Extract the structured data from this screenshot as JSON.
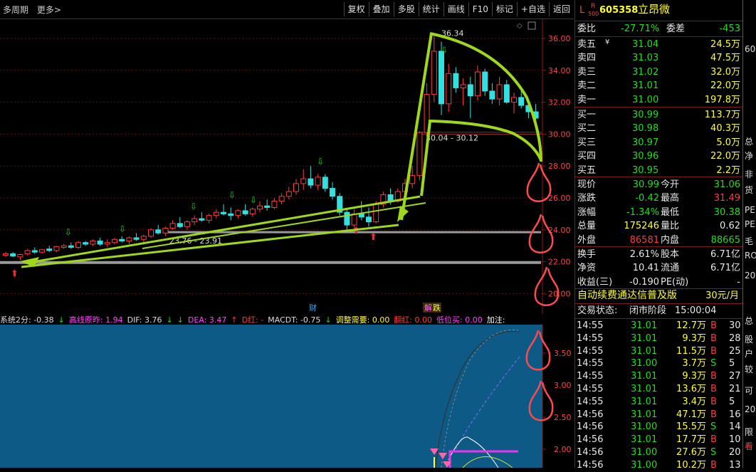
{
  "toolbar": {
    "period": "多周期",
    "more": "更多>",
    "buttons": [
      "复权",
      "叠加",
      "多股",
      "统计",
      "画线",
      "F10",
      "标记",
      "+自选",
      "返回"
    ]
  },
  "header": {
    "badge_l": "L",
    "badge_r": "R",
    "badge_500": "500",
    "code": "605358",
    "name": "立昂微"
  },
  "order_book": {
    "weibi_label": "委比",
    "weibi_value": "-27.71%",
    "weicha_label": "委差",
    "weicha_value": "-453",
    "asks": [
      {
        "label": "卖五",
        "mark": "¥",
        "price": "31.04",
        "vol": "24.5万"
      },
      {
        "label": "卖四",
        "mark": "",
        "price": "31.03",
        "vol": "47.5万"
      },
      {
        "label": "卖三",
        "mark": "",
        "price": "31.02",
        "vol": "32.0万"
      },
      {
        "label": "卖二",
        "mark": "",
        "price": "31.01",
        "vol": "22.0万"
      },
      {
        "label": "卖一",
        "mark": "",
        "price": "31.00",
        "vol": "197.8万"
      }
    ],
    "bids": [
      {
        "label": "买一",
        "price": "30.99",
        "vol": "113.7万"
      },
      {
        "label": "买二",
        "price": "30.98",
        "vol": "40.3万"
      },
      {
        "label": "买三",
        "price": "30.97",
        "vol": "5.0万"
      },
      {
        "label": "买四",
        "price": "30.96",
        "vol": "22.0万"
      },
      {
        "label": "买五",
        "price": "30.95",
        "vol": "2.2万"
      }
    ]
  },
  "quote": {
    "rows": [
      {
        "l1": "现价",
        "v1": "30.99",
        "c1": "grn",
        "l2": "今开",
        "v2": "31.06",
        "c2": "grn"
      },
      {
        "l1": "涨跌",
        "v1": "-0.42",
        "c1": "grn",
        "l2": "最高",
        "v2": "31.49",
        "c2": "red"
      },
      {
        "l1": "涨幅",
        "v1": "-1.34%",
        "c1": "grn",
        "l2": "最低",
        "v2": "30.38",
        "c2": "grn"
      },
      {
        "l1": "总量",
        "v1": "175246",
        "c1": "yel",
        "l2": "量比",
        "v2": "0.62",
        "c2": "wht"
      },
      {
        "l1": "外盘",
        "v1": "86581",
        "c1": "red",
        "l2": "内盘",
        "v2": "88665",
        "c2": "grn"
      }
    ],
    "rows2": [
      {
        "l1": "换手",
        "v1": "2.61%",
        "l2": "股本",
        "v2": "6.71亿"
      },
      {
        "l1": "净资",
        "v1": "10.41",
        "l2": "流通",
        "v2": "6.71亿"
      },
      {
        "l1": "收益(三)",
        "v1": "-0.190",
        "l2": "PE(动)",
        "v2": "-"
      }
    ]
  },
  "promo": {
    "text": "自动续费通达信普及版",
    "price": "30元/月"
  },
  "trade_status": {
    "label": "交易状态:",
    "value": "闭市阶段",
    "time": "15:00:04"
  },
  "ticks": [
    {
      "t": "14:55",
      "p": "31.01",
      "v": "12.7万",
      "d": "B",
      "n": "30"
    },
    {
      "t": "14:55",
      "p": "31.01",
      "v": "9.3万",
      "d": "B",
      "n": "28"
    },
    {
      "t": "14:55",
      "p": "31.01",
      "v": "11.5万",
      "d": "B",
      "n": "25"
    },
    {
      "t": "14:55",
      "p": "31.00",
      "v": "3.7万",
      "d": "S",
      "n": "5"
    },
    {
      "t": "14:55",
      "p": "31.01",
      "v": "9.3万",
      "d": "B",
      "n": "27"
    },
    {
      "t": "14:55",
      "p": "31.01",
      "v": "13.6万",
      "d": "B",
      "n": "21"
    },
    {
      "t": "14:55",
      "p": "31.01",
      "v": "3.4万",
      "d": "B",
      "n": "5"
    },
    {
      "t": "14:56",
      "p": "31.01",
      "v": "47.1万",
      "d": "B",
      "n": "16"
    },
    {
      "t": "14:56",
      "p": "31.00",
      "v": "15.5万",
      "d": "S",
      "n": "14"
    },
    {
      "t": "14:56",
      "p": "31.01",
      "v": "17.7万",
      "d": "B",
      "n": "10"
    },
    {
      "t": "14:56",
      "p": "31.00",
      "v": "27.6万",
      "d": "S",
      "n": "20"
    },
    {
      "t": "14:56",
      "p": "31.00",
      "v": "10.2万",
      "d": "B",
      "n": "13"
    }
  ],
  "price_axis": [
    "36.00",
    "34.00",
    "32.00",
    "30.00",
    "28.00",
    "26.00",
    "24.00",
    "22.00",
    "20.00"
  ],
  "ind_axis": [
    "3.50",
    "3.00",
    "2.50",
    "2.00"
  ],
  "annotations": {
    "high": "36.34",
    "gap": "30.04 - 30.12",
    "support": "23.76 - 23.91",
    "cai": "财",
    "jie": "解",
    "die": "跌"
  },
  "indicator_bar": [
    {
      "text": "系统2分: -0.38",
      "color": "#dddddd"
    },
    {
      "text": "↓",
      "color": "#22dd22"
    },
    {
      "text": "高线原昨: 1.94",
      "color": "#ff44ff"
    },
    {
      "text": "DIF: 3.76",
      "color": "#dddddd"
    },
    {
      "text": "↓",
      "color": "#22dd22"
    },
    {
      "text": "↓",
      "color": "#22dd22"
    },
    {
      "text": "DEA: 3.47",
      "color": "#ff44ff"
    },
    {
      "text": "↑",
      "color": "#ff3b3b"
    },
    {
      "text": "D红: -",
      "color": "#ff3b3b"
    },
    {
      "text": "MACDT: -0.75",
      "color": "#dddddd"
    },
    {
      "text": "↓",
      "color": "#22dd22"
    },
    {
      "text": "调整需要: 0.00",
      "color": "#ffff33"
    },
    {
      "text": "翻红: 0.00",
      "color": "#ff3b3b"
    },
    {
      "text": "低位买: 0.00",
      "color": "#ff44ff"
    },
    {
      "text": "加注:",
      "color": "#ffffff"
    }
  ],
  "edge_labels": [
    "60",
    "总",
    "净",
    "非",
    "货",
    "PE",
    "PE",
    "毛",
    "RO",
    "20",
    "总",
    "股",
    "户",
    "较",
    "可",
    "20",
    "限",
    "看"
  ],
  "colors": {
    "up": "#ff3b3b",
    "down": "#33e0e0",
    "annotation_green": "#9ed81b",
    "annotation_red": "#ff4a4a",
    "indicator_bg": "#0d5a86"
  }
}
